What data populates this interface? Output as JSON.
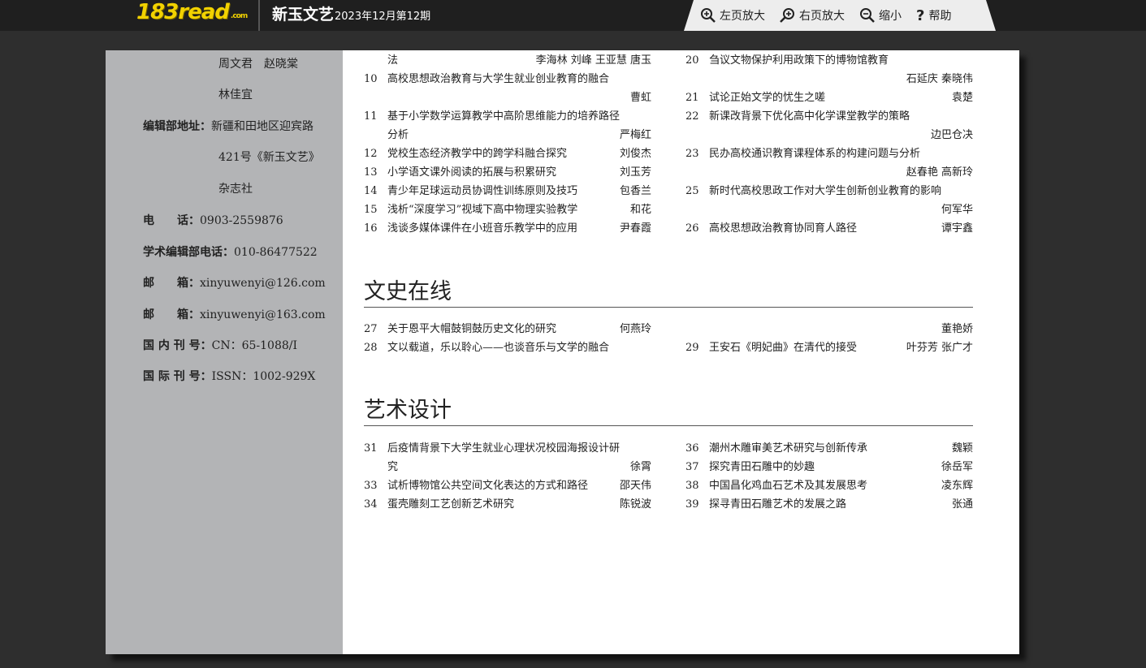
{
  "header": {
    "logo_text": "183",
    "logo_text2": "read",
    "logo_sub": ".com",
    "title": "新玉文艺",
    "issue": "2023年12月第12期"
  },
  "toolbar": {
    "zoom_left_label": "左页放大",
    "zoom_right_label": "右页放大",
    "zoom_out_label": "缩小",
    "help_label": "帮助"
  },
  "sidebar": {
    "editors_line1": "周文君　赵晓棠",
    "editors_line2": "林佳宜",
    "address_label": "编辑部地址：",
    "address_line1": "新疆和田地区迎宾路",
    "address_line2": "421号《新玉文艺》",
    "address_line3": "杂志社",
    "phone_label": "电　　话：",
    "phone_value": "0903-2559876",
    "academic_phone_label": "学术编辑部电话：",
    "academic_phone_value": "010-86477522",
    "email_label": "邮　　箱：",
    "email1": "xinyuwenyi@126.com",
    "email2": "xinyuwenyi@163.com",
    "domestic_label": "国 内 刊 号：",
    "domestic_value": "CN：65-1088/I",
    "intl_label": "国 际 刊 号：",
    "intl_value": "ISSN：1002-929X"
  },
  "toc": {
    "top_left": [
      {
        "num": "",
        "title": "法",
        "author": "李海林  刘峰  王亚慧  唐玉"
      },
      {
        "num": "10",
        "title": "高校思想政治教育与大学生就业创业教育的融合",
        "author": ""
      },
      {
        "num": "",
        "title": "",
        "author": "曹虹"
      },
      {
        "num": "11",
        "title": "基于小学数学运算教学中高阶思维能力的培养路径",
        "author": ""
      },
      {
        "num": "",
        "title": "分析",
        "author": "严梅红"
      },
      {
        "num": "12",
        "title": "党校生态经济教学中的跨学科融合探究",
        "author": "刘俊杰"
      },
      {
        "num": "13",
        "title": "小学语文课外阅读的拓展与积累研究",
        "author": "刘玉芳"
      },
      {
        "num": "14",
        "title": "青少年足球运动员协调性训练原则及技巧",
        "author": "包香兰"
      },
      {
        "num": "15",
        "title": "浅析“深度学习”视域下高中物理实验教学",
        "author": "和花"
      },
      {
        "num": "16",
        "title": "浅谈多媒体课件在小班音乐教学中的应用",
        "author": "尹春霞"
      }
    ],
    "top_right": [
      {
        "num": "20",
        "title": "刍议文物保护利用政策下的博物馆教育",
        "author": ""
      },
      {
        "num": "",
        "title": "",
        "author": "石延庆  秦晓伟"
      },
      {
        "num": "21",
        "title": "试论正始文学的忧生之嗟",
        "author": "袁楚"
      },
      {
        "num": "22",
        "title": "新课改背景下优化高中化学课堂教学的策略",
        "author": ""
      },
      {
        "num": "",
        "title": "",
        "author": "边巴仓决"
      },
      {
        "num": "23",
        "title": "民办高校通识教育课程体系的构建问题与分析",
        "author": ""
      },
      {
        "num": "",
        "title": "",
        "author": "赵春艳  高新玲"
      },
      {
        "num": "25",
        "title": "新时代高校思政工作对大学生创新创业教育的影响",
        "author": ""
      },
      {
        "num": "",
        "title": "",
        "author": "何军华"
      },
      {
        "num": "26",
        "title": "高校思想政治教育协同育人路径",
        "author": "谭宇鑫"
      }
    ],
    "section2_title": "文史在线",
    "s2_left": [
      {
        "num": "27",
        "title": "关于恩平大帽鼓铜鼓历史文化的研究",
        "author": "何燕玲"
      },
      {
        "num": "28",
        "title": "文以载道，乐以聆心——也谈音乐与文学的融合",
        "author": ""
      }
    ],
    "s2_right": [
      {
        "num": "",
        "title": "",
        "author": "董艳娇"
      },
      {
        "num": "29",
        "title": "王安石《明妃曲》在清代的接受",
        "author": "叶芬芳  张广才"
      }
    ],
    "section3_title": "艺术设计",
    "s3_left": [
      {
        "num": "31",
        "title": "后疫情背景下大学生就业心理状况校园海报设计研",
        "author": ""
      },
      {
        "num": "",
        "title": "究",
        "author": "徐霄"
      },
      {
        "num": "33",
        "title": "试析博物馆公共空间文化表达的方式和路径",
        "author": "邵天伟"
      },
      {
        "num": "34",
        "title": "蛋壳雕刻工艺创新艺术研究",
        "author": "陈锐波"
      }
    ],
    "s3_right": [
      {
        "num": "36",
        "title": "潮州木雕审美艺术研究与创新传承",
        "author": "魏颖"
      },
      {
        "num": "37",
        "title": "探究青田石雕中的妙趣",
        "author": "徐岳军"
      },
      {
        "num": "38",
        "title": "中国昌化鸡血石艺术及其发展思考",
        "author": "凌东辉"
      },
      {
        "num": "39",
        "title": "探寻青田石雕艺术的发展之路",
        "author": "张通"
      }
    ]
  },
  "colors": {
    "background": "#2e2e2e",
    "topbar": "#1f1f1f",
    "logo": "#f2d200",
    "toolbar": "#ededed",
    "sidebar": "#b3b4b6"
  }
}
